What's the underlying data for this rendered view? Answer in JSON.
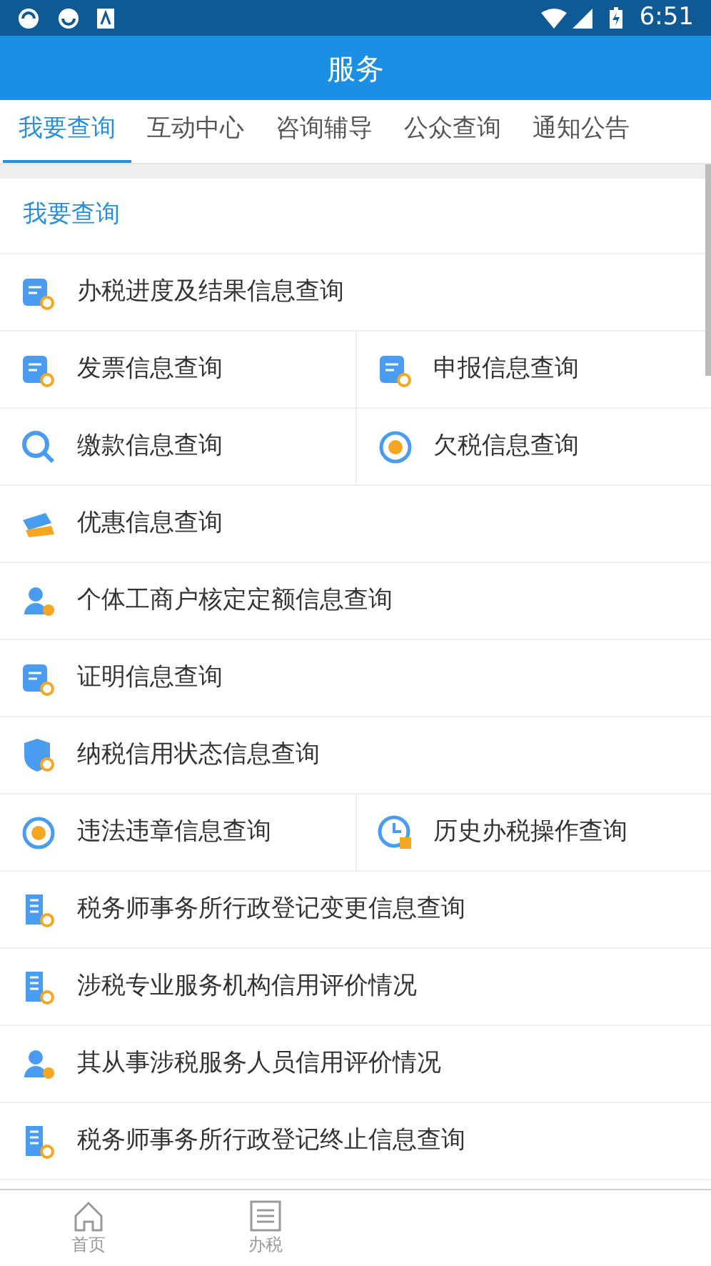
{
  "status_bar": {
    "time": "6:51"
  },
  "header": {
    "title": "服务"
  },
  "tabs": [
    {
      "label": "我要查询",
      "selected": true
    },
    {
      "label": "互动中心",
      "selected": false
    },
    {
      "label": "咨询辅导",
      "selected": false
    },
    {
      "label": "公众查询",
      "selected": false
    },
    {
      "label": "通知公告",
      "selected": false
    }
  ],
  "section": {
    "title": "我要查询"
  },
  "rows": [
    [
      {
        "label": "办税进度及结果信息查询",
        "kind": "doc"
      }
    ],
    [
      {
        "label": "发票信息查询",
        "kind": "doc"
      },
      {
        "label": "申报信息查询",
        "kind": "doc"
      }
    ],
    [
      {
        "label": "缴款信息查询",
        "kind": "magnifier"
      },
      {
        "label": "欠税信息查询",
        "kind": "circle"
      }
    ],
    [
      {
        "label": "优惠信息查询",
        "kind": "ticket"
      }
    ],
    [
      {
        "label": "个体工商户核定定额信息查询",
        "kind": "person"
      }
    ],
    [
      {
        "label": "证明信息查询",
        "kind": "doc"
      }
    ],
    [
      {
        "label": "纳税信用状态信息查询",
        "kind": "shield"
      }
    ],
    [
      {
        "label": "违法违章信息查询",
        "kind": "circle"
      },
      {
        "label": "历史办税操作查询",
        "kind": "clock"
      }
    ],
    [
      {
        "label": "税务师事务所行政登记变更信息查询",
        "kind": "building"
      }
    ],
    [
      {
        "label": "涉税专业服务机构信用评价情况",
        "kind": "building"
      }
    ],
    [
      {
        "label": "其从事涉税服务人员信用评价情况",
        "kind": "person"
      }
    ],
    [
      {
        "label": "税务师事务所行政登记终止信息查询",
        "kind": "building"
      }
    ]
  ],
  "bottom_nav": [
    {
      "label": "首页",
      "kind": "home"
    },
    {
      "label": "办税",
      "kind": "list"
    }
  ]
}
